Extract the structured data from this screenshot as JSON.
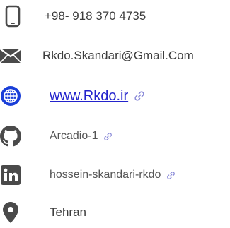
{
  "contact": {
    "phone": "+98- 918 370 4735",
    "email": "Rkdo.Skandari@Gmail.Com",
    "website": "www.Rkdo.ir",
    "github": "Arcadio-1",
    "linkedin": "hossein-skandari-rkdo",
    "location": "Tehran"
  },
  "icons": {
    "phone": "smartphone-icon",
    "email": "envelope-icon",
    "website": "globe-icon",
    "github": "github-icon",
    "linkedin": "linkedin-icon",
    "location": "map-pin-icon",
    "external": "link-icon"
  },
  "colors": {
    "text": "#3c3c3c",
    "icon_gray": "#4a4a4a",
    "globe_blue": "#1a3fd8",
    "website_link": "#2323cc",
    "link_muted": "#555555",
    "link_icon": "#8a8ad8"
  }
}
